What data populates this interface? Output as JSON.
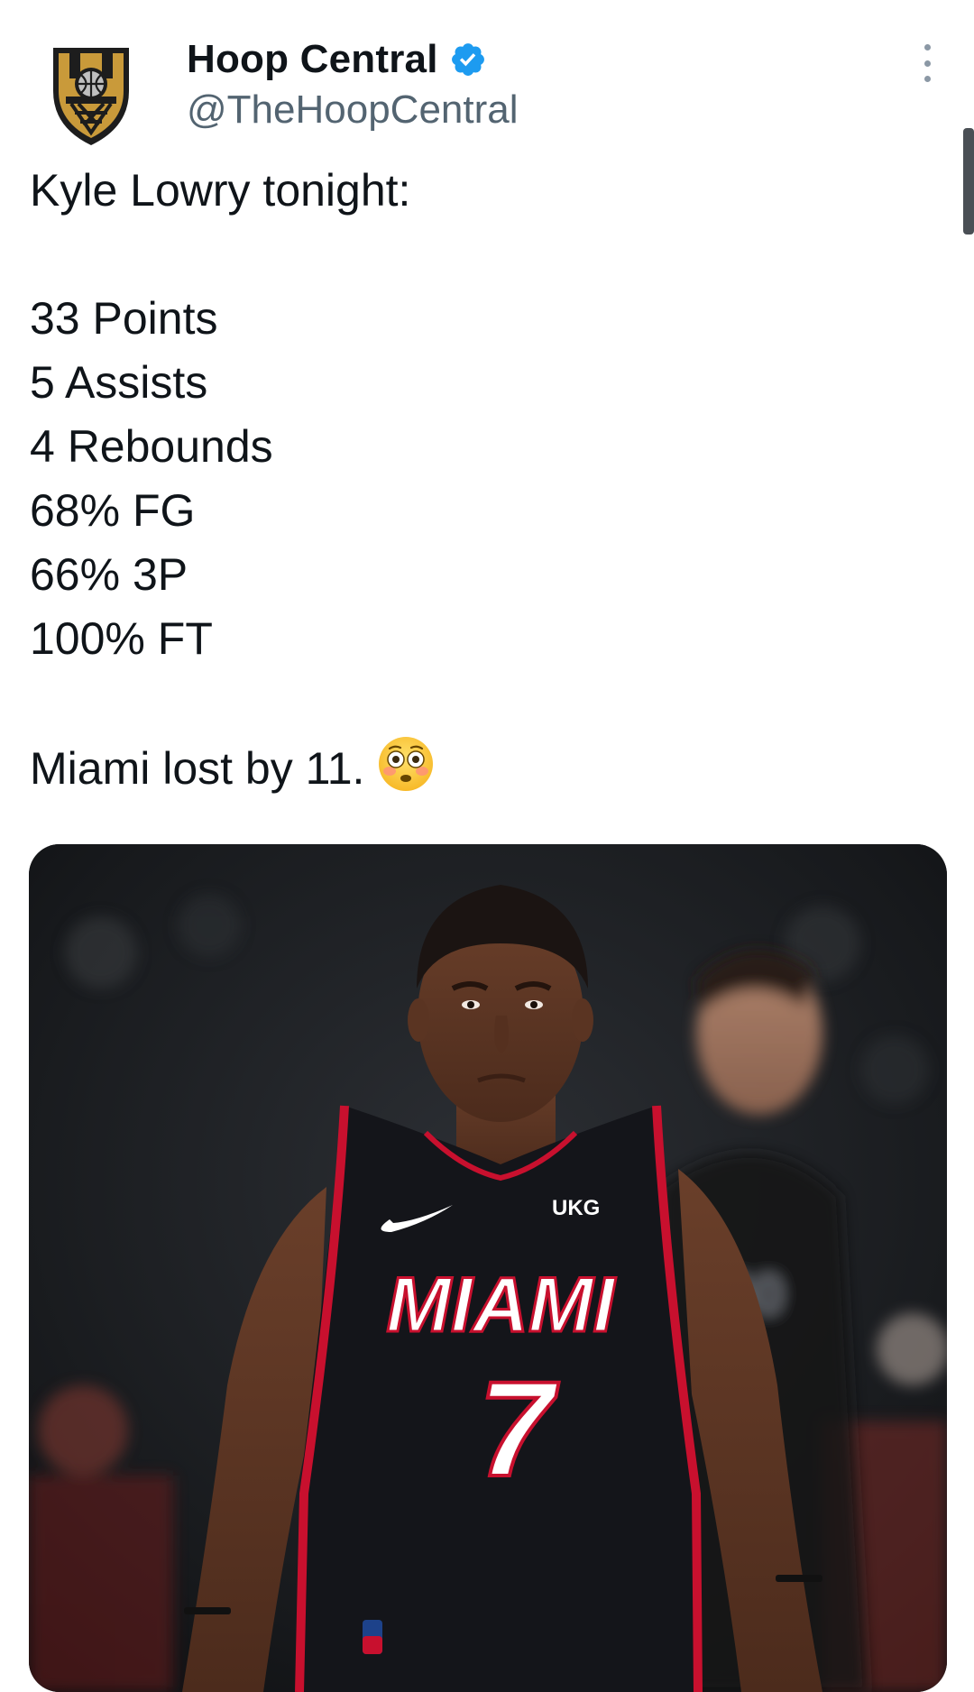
{
  "author": {
    "display_name": "Hoop Central",
    "handle": "@TheHoopCentral",
    "verified": true,
    "avatar_icon": "hoop-central-logo-icon"
  },
  "tweet": {
    "lines": [
      "Kyle Lowry tonight:",
      "",
      "33 Points",
      "5 Assists",
      "4 Rebounds",
      "68% FG",
      "66% 3P",
      "100% FT",
      "",
      "Miami lost by 11."
    ],
    "emoji": "flushed-face-emoji"
  },
  "media": {
    "type": "photo",
    "jersey_team": "MIAMI",
    "jersey_number": "7",
    "jersey_sponsor": "UKG"
  },
  "colors": {
    "text": "#0f1419",
    "secondary": "#536471",
    "verified_blue": "#1d9bf0"
  },
  "icons": [
    "verified-badge-icon",
    "more-options-icon"
  ]
}
